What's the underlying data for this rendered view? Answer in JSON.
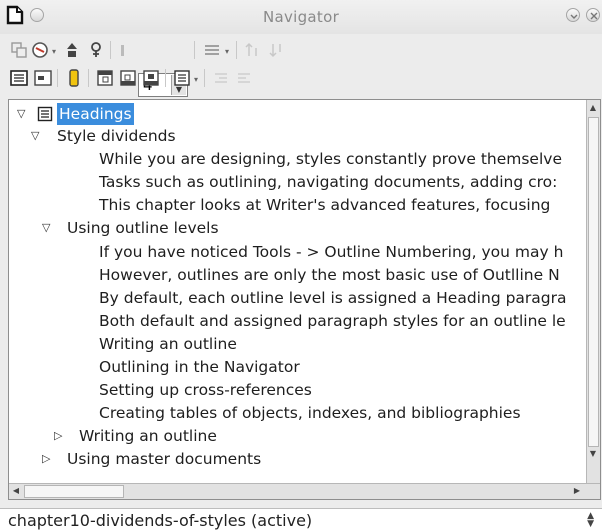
{
  "window": {
    "title": "Navigator"
  },
  "toolbar": {
    "level_value": "4"
  },
  "tree": {
    "root_label": "Headings",
    "rows": [
      {
        "text": "Style dividends",
        "toggle": "expanded"
      },
      {
        "text": "While you are designing, styles constantly prove themselve"
      },
      {
        "text": "Tasks such as  outlining, navigating documents, adding cro:"
      },
      {
        "text": "This chapter looks at Writer's advanced features, focusing"
      },
      {
        "text": "Using outline levels",
        "toggle": "expanded"
      },
      {
        "text": "If you have noticed Tools - > Outline Numbering, you may h"
      },
      {
        "text": "However, outlines are only the most basic use of Outlline N"
      },
      {
        "text": "By default, each outline level is assigned a Heading paragra"
      },
      {
        "text": "Both default and assigned paragraph styles for an outline le"
      },
      {
        "text": "Writing an outline"
      },
      {
        "text": "Outlining in the Navigator"
      },
      {
        "text": "Setting up cross-references"
      },
      {
        "text": "Creating tables of objects, indexes, and bibliographies"
      },
      {
        "text": "Writing an outline",
        "toggle": "collapsed"
      },
      {
        "text": "Using master documents",
        "toggle": "collapsed"
      }
    ]
  },
  "document_selector": {
    "value": "chapter10-dividends-of-styles (active)"
  },
  "colors": {
    "selection": "#3b8ddd",
    "panel_bg": "#ececec"
  }
}
